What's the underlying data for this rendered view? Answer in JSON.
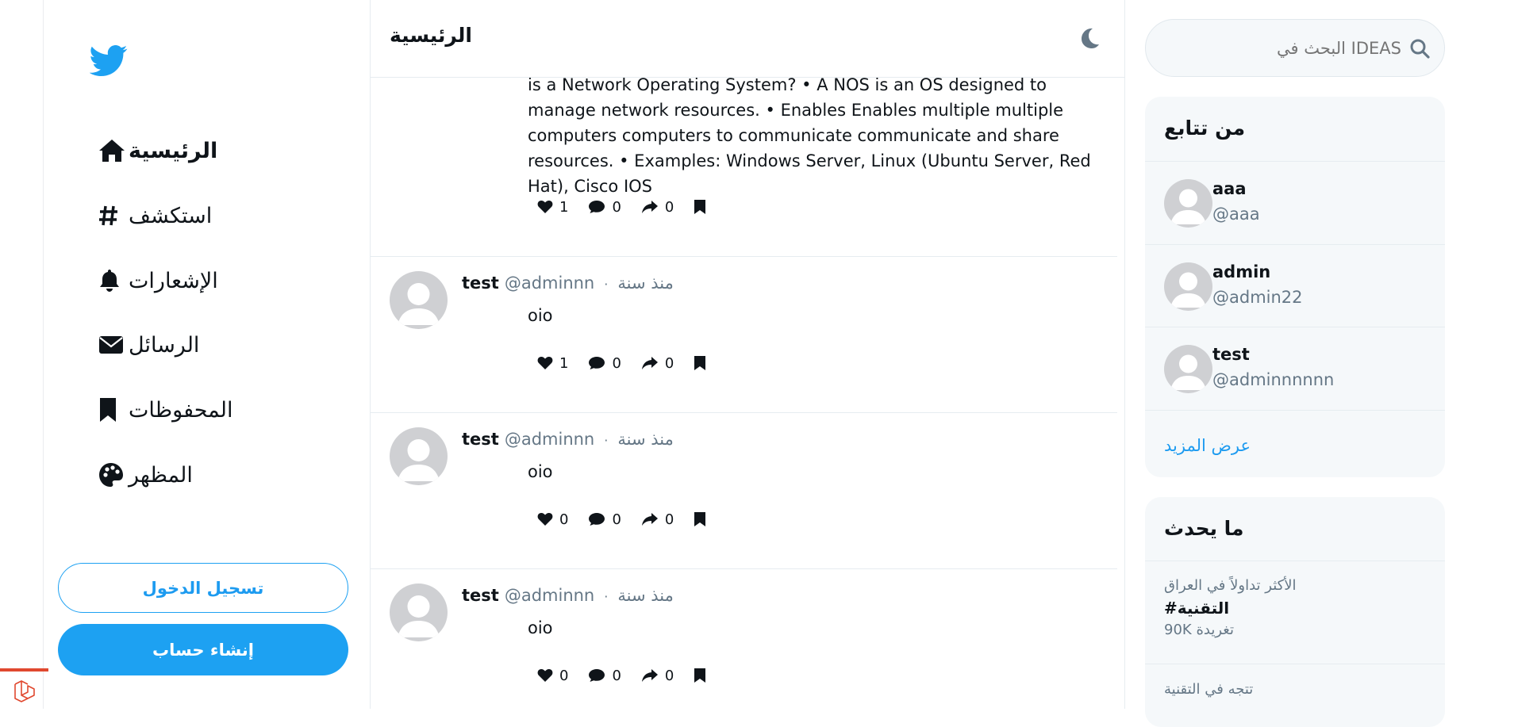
{
  "nav": {
    "items": [
      {
        "label": "الرئيسية",
        "icon": "home-icon"
      },
      {
        "label": "استكشف",
        "icon": "hashtag-icon"
      },
      {
        "label": "الإشعارات",
        "icon": "bell-icon"
      },
      {
        "label": "الرسائل",
        "icon": "envelope-icon"
      },
      {
        "label": "المحفوظات",
        "icon": "bookmark-icon"
      },
      {
        "label": "المظهر",
        "icon": "palette-icon"
      }
    ],
    "login_label": "تسجيل الدخول",
    "signup_label": "إنشاء حساب"
  },
  "header": {
    "title": "الرئيسية"
  },
  "feed": {
    "first_tweet": {
      "text": "is a Network Operating System? • A NOS is an OS designed to manage network resources. • Enables Enables multiple multiple computers computers to communicate communicate and share resources. • Examples: Windows Server, Linux (Ubuntu Server, Red Hat), Cisco IOS",
      "likes": "1",
      "comments": "0",
      "shares": "0"
    },
    "tweets": [
      {
        "name": "test",
        "handle": "@adminnn",
        "time": "منذ سنة",
        "text": "oio",
        "likes": "1",
        "comments": "0",
        "shares": "0"
      },
      {
        "name": "test",
        "handle": "@adminnn",
        "time": "منذ سنة",
        "text": "oio",
        "likes": "0",
        "comments": "0",
        "shares": "0"
      },
      {
        "name": "test",
        "handle": "@adminnn",
        "time": "منذ سنة",
        "text": "oio",
        "likes": "0",
        "comments": "0",
        "shares": "0"
      }
    ],
    "dot": "·"
  },
  "search": {
    "placeholder": "IDEAS البحث في"
  },
  "who_to_follow": {
    "title": "من تتابع",
    "users": [
      {
        "name": "aaa",
        "handle": "@aaa"
      },
      {
        "name": "admin",
        "handle": "@admin22"
      },
      {
        "name": "test",
        "handle": "@adminnnnnn"
      }
    ],
    "show_more": "عرض المزيد"
  },
  "whats_happening": {
    "title": "ما يحدث",
    "trends": [
      {
        "context": "الأكثر تداولاً في العراق",
        "tag": "#التقنية",
        "count": "90K تغريدة"
      },
      {
        "context": "تتجه في التقنية",
        "tag": "",
        "count": ""
      }
    ]
  },
  "colors": {
    "accent": "#1da1f2",
    "text": "#0f1419",
    "muted": "#657786",
    "panel": "#f5f8fa"
  }
}
